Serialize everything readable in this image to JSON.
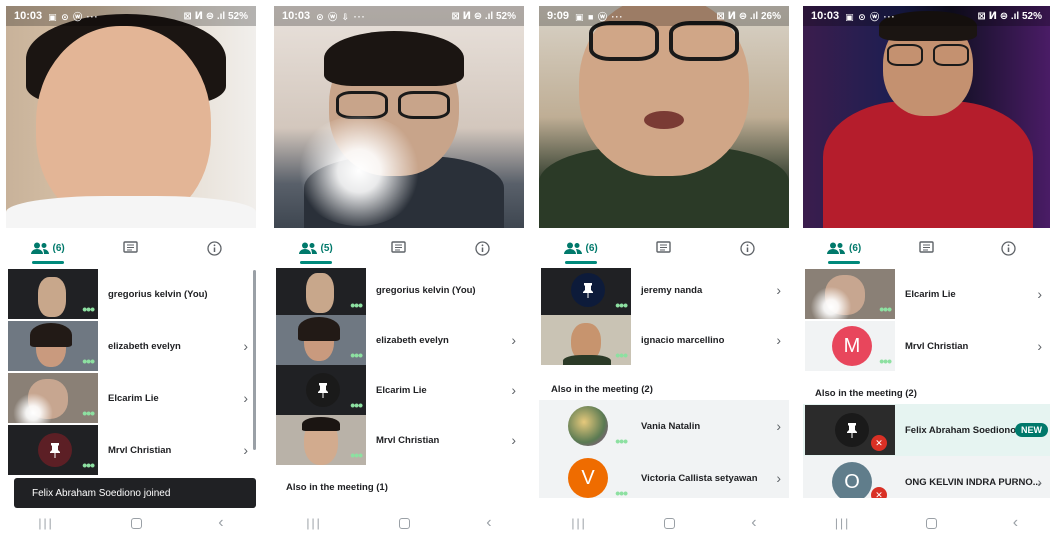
{
  "screens": [
    {
      "status": {
        "time": "10:03",
        "left_icons": "▣ ⊙ ⓦ ···",
        "right": "⊠ ⵍ ⊜ .ıl 52%"
      },
      "tabs": {
        "people_count": "(6)"
      },
      "participants": [
        {
          "name": "gregorius kelvin (You)"
        },
        {
          "name": "elizabeth evelyn"
        },
        {
          "name": "Elcarim Lie"
        },
        {
          "name": "Mrvl Christian"
        }
      ],
      "toast": "Felix Abraham Soediono joined"
    },
    {
      "status": {
        "time": "10:03",
        "left_icons": "⊙ ⓦ ⇩ ···",
        "right": "⊠ ⵍ ⊜ .ıl 52%"
      },
      "tabs": {
        "people_count": "(5)"
      },
      "participants": [
        {
          "name": "gregorius kelvin (You)"
        },
        {
          "name": "elizabeth evelyn"
        },
        {
          "name": "Elcarim Lie"
        },
        {
          "name": "Mrvl Christian"
        }
      ],
      "also_label": "Also in the meeting (1)"
    },
    {
      "status": {
        "time": "9:09",
        "left_icons": "▣ ■ ⓦ ···",
        "right": "⊠ ⵍ ⊜ .ıl 26%"
      },
      "tabs": {
        "people_count": "(6)"
      },
      "participants": [
        {
          "name": "jeremy nanda"
        },
        {
          "name": "ignacio marcellino"
        }
      ],
      "also_label": "Also in the meeting (2)",
      "also": [
        {
          "name": "Vania Natalin"
        },
        {
          "name": "Victoria Callista setyawan",
          "letter": "V"
        }
      ]
    },
    {
      "status": {
        "time": "10:03",
        "left_icons": "▣ ⊙ ⓦ ···",
        "right": "⊠ ⵍ ⊜ .ıl 52%"
      },
      "tabs": {
        "people_count": "(6)"
      },
      "participants": [
        {
          "name": "Elcarim Lie"
        },
        {
          "name": "Mrvl Christian",
          "letter": "M"
        }
      ],
      "also_label": "Also in the meeting (2)",
      "also": [
        {
          "name": "Felix Abraham Soediono",
          "badge": "NEW"
        },
        {
          "name": "ONG KELVIN INDRA PURNO...",
          "letter": "O"
        }
      ]
    }
  ],
  "colors": {
    "accent": "#00796b",
    "letter_m": "#e8465c",
    "letter_v": "#ef6c00",
    "letter_o": "#607d8b",
    "mute_red": "#d93025",
    "new_highlight": "#e6f4f1"
  },
  "icons": {
    "people": "people-icon",
    "chat": "chat-icon",
    "info": "info-icon",
    "chevron": "chevron-right-icon",
    "pin": "pin-icon",
    "mic_off": "mic-off-icon"
  },
  "glyphs": {
    "chevron": "›",
    "dots": "•••",
    "mic_off": "✕",
    "recent": "|||",
    "back": "‹"
  }
}
